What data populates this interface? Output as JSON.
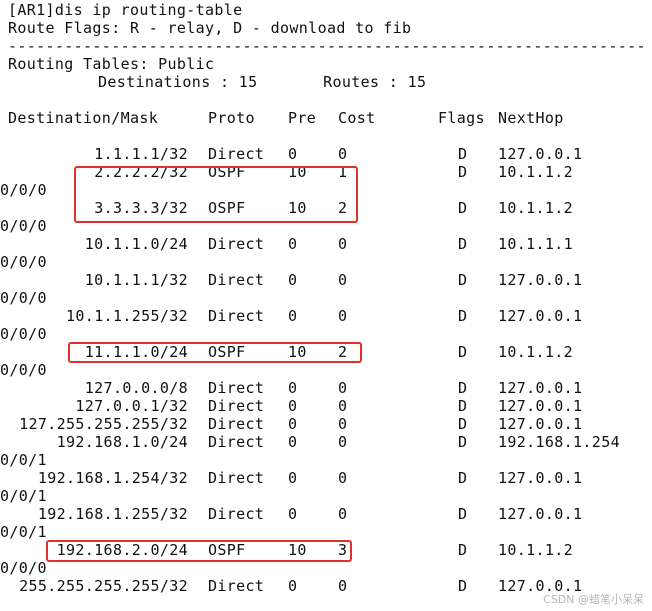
{
  "header": {
    "command": "[AR1]dis ip routing-table",
    "flags_legend": "Route Flags: R - relay, D - download to fib",
    "separator": "------------------------------------------------------------------------------",
    "tables_label": "Routing Tables: Public",
    "summary": "Destinations : 15       Routes : 15"
  },
  "columns": {
    "destination": "Destination/Mask",
    "proto": "Proto",
    "pre": "Pre",
    "cost": "Cost",
    "flags": "Flags",
    "nexthop": "NextHop"
  },
  "routes": [
    {
      "dest": "1.1.1.1/32",
      "proto": "Direct",
      "pre": "0",
      "cost": "0",
      "flags": "D",
      "nexthop": "127.0.0.1",
      "iface": ""
    },
    {
      "dest": "2.2.2.2/32",
      "proto": "OSPF",
      "pre": "10",
      "cost": "1",
      "flags": "D",
      "nexthop": "10.1.1.2",
      "iface": "0/0/0"
    },
    {
      "dest": "3.3.3.3/32",
      "proto": "OSPF",
      "pre": "10",
      "cost": "2",
      "flags": "D",
      "nexthop": "10.1.1.2",
      "iface": "0/0/0"
    },
    {
      "dest": "10.1.1.0/24",
      "proto": "Direct",
      "pre": "0",
      "cost": "0",
      "flags": "D",
      "nexthop": "10.1.1.1",
      "iface": "0/0/0"
    },
    {
      "dest": "10.1.1.1/32",
      "proto": "Direct",
      "pre": "0",
      "cost": "0",
      "flags": "D",
      "nexthop": "127.0.0.1",
      "iface": "0/0/0"
    },
    {
      "dest": "10.1.1.255/32",
      "proto": "Direct",
      "pre": "0",
      "cost": "0",
      "flags": "D",
      "nexthop": "127.0.0.1",
      "iface": "0/0/0"
    },
    {
      "dest": "11.1.1.0/24",
      "proto": "OSPF",
      "pre": "10",
      "cost": "2",
      "flags": "D",
      "nexthop": "10.1.1.2",
      "iface": "0/0/0"
    },
    {
      "dest": "127.0.0.0/8",
      "proto": "Direct",
      "pre": "0",
      "cost": "0",
      "flags": "D",
      "nexthop": "127.0.0.1",
      "iface": ""
    },
    {
      "dest": "127.0.0.1/32",
      "proto": "Direct",
      "pre": "0",
      "cost": "0",
      "flags": "D",
      "nexthop": "127.0.0.1",
      "iface": ""
    },
    {
      "dest": "127.255.255.255/32",
      "proto": "Direct",
      "pre": "0",
      "cost": "0",
      "flags": "D",
      "nexthop": "127.0.0.1",
      "iface": ""
    },
    {
      "dest": "192.168.1.0/24",
      "proto": "Direct",
      "pre": "0",
      "cost": "0",
      "flags": "D",
      "nexthop": "192.168.1.254",
      "iface": "0/0/1"
    },
    {
      "dest": "192.168.1.254/32",
      "proto": "Direct",
      "pre": "0",
      "cost": "0",
      "flags": "D",
      "nexthop": "127.0.0.1",
      "iface": "0/0/1"
    },
    {
      "dest": "192.168.1.255/32",
      "proto": "Direct",
      "pre": "0",
      "cost": "0",
      "flags": "D",
      "nexthop": "127.0.0.1",
      "iface": "0/0/1"
    },
    {
      "dest": "192.168.2.0/24",
      "proto": "OSPF",
      "pre": "10",
      "cost": "3",
      "flags": "D",
      "nexthop": "10.1.1.2",
      "iface": "0/0/0"
    },
    {
      "dest": "255.255.255.255/32",
      "proto": "Direct",
      "pre": "0",
      "cost": "0",
      "flags": "D",
      "nexthop": "127.0.0.1",
      "iface": ""
    }
  ],
  "highlight_color": "#e0312a",
  "watermark": "CSDN @蜡笔小呆呆"
}
